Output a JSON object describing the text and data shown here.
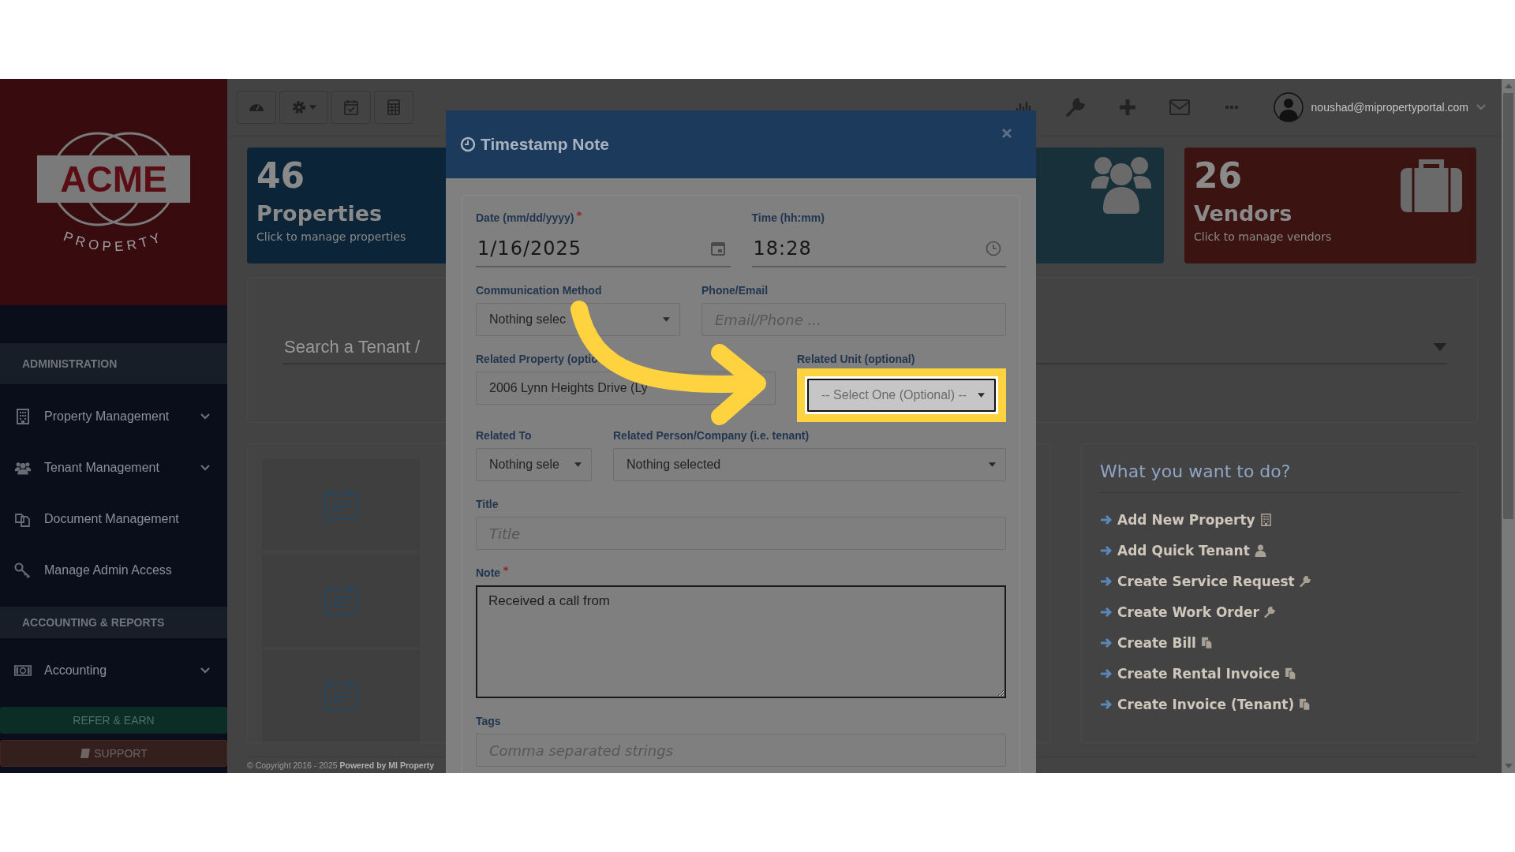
{
  "sidebar": {
    "logo": {
      "name": "ACME",
      "tagline": "PROPERTY"
    },
    "sections": [
      {
        "heading": "ADMINISTRATION",
        "items": [
          {
            "label": "Property Management",
            "expandable": true
          },
          {
            "label": "Tenant Management",
            "expandable": true
          },
          {
            "label": "Document Management",
            "expandable": false
          },
          {
            "label": "Manage Admin Access",
            "expandable": false
          }
        ]
      },
      {
        "heading": "ACCOUNTING & REPORTS",
        "items": [
          {
            "label": "Accounting",
            "expandable": true
          }
        ]
      }
    ],
    "buttons": [
      {
        "label": "REFER & EARN",
        "kind": "refer"
      },
      {
        "label": "SUPPORT",
        "kind": "support"
      }
    ]
  },
  "topbar": {
    "user_email": "noushad@mipropertyportal.com"
  },
  "stat_cards": [
    {
      "kind": "properties",
      "count": "46",
      "label": "Properties",
      "hint": "Click to manage properties"
    },
    {
      "kind": "tenants"
    },
    {
      "kind": "vendors",
      "count": "26",
      "label": "Vendors",
      "hint": "Click to manage vendors"
    }
  ],
  "search": {
    "placeholder": "Search a Tenant /"
  },
  "quick_actions": {
    "title": "What you want to do?",
    "links": [
      {
        "label": "Add New Property"
      },
      {
        "label": "Add Quick Tenant"
      },
      {
        "label": "Create Service Request"
      },
      {
        "label": "Create Work Order"
      },
      {
        "label": "Create Bill"
      },
      {
        "label": "Create Rental Invoice"
      },
      {
        "label": "Create Invoice (Tenant)"
      }
    ]
  },
  "footer": {
    "text": "© Copyright 2016 - 2025 **Powered by MI Property**"
  },
  "modal": {
    "title": "Timestamp Note",
    "rows": [
      [
        {
          "kind": "date",
          "label": "Date (mm/dd/yyyy)",
          "required": true,
          "value": "1/16/2025",
          "disabled": false,
          "highlighted": false
        },
        {
          "kind": "time",
          "label": "Time (hh:mm)",
          "required": false,
          "value": "18:28",
          "disabled": false,
          "highlighted": false
        }
      ],
      [
        {
          "kind": "select",
          "label": "Communication Method",
          "required": false,
          "value": "Nothing selec",
          "disabled": false,
          "highlighted": false
        },
        {
          "kind": "text",
          "label": "Phone/Email",
          "required": false,
          "placeholder": "Email/Phone ...",
          "disabled": false,
          "highlighted": false
        }
      ],
      [
        {
          "kind": "select",
          "label": "Related Property (optio",
          "required": false,
          "value": "2006 Lynn Heights Drive (Ly",
          "disabled": false,
          "highlighted": false
        },
        {
          "kind": "select",
          "label": "Related Unit (optional)",
          "required": false,
          "value": "-- Select One (Optional) --",
          "disabled": true,
          "highlighted": true
        }
      ],
      [
        {
          "kind": "select",
          "label": "Related To",
          "required": false,
          "value": "Nothing sele",
          "disabled": false,
          "highlighted": false
        },
        {
          "kind": "select",
          "label": "Related Person/Company (i.e. tenant)",
          "required": false,
          "value": "Nothing selected",
          "disabled": false,
          "highlighted": false
        }
      ],
      [
        {
          "kind": "text",
          "label": "Title",
          "required": false,
          "placeholder": "Title",
          "disabled": false,
          "highlighted": false
        }
      ],
      [
        {
          "kind": "textarea",
          "label": "Note",
          "required": true,
          "value": "Received a call from",
          "disabled": false,
          "highlighted": false
        }
      ],
      [
        {
          "kind": "text",
          "label": "Tags",
          "required": false,
          "placeholder": "Comma separated strings",
          "disabled": false,
          "highlighted": false
        }
      ]
    ]
  }
}
